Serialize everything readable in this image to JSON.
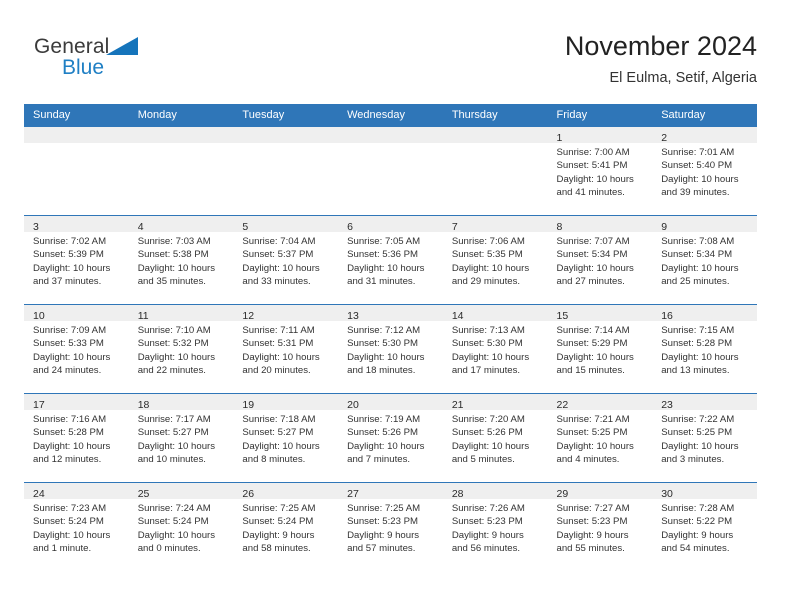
{
  "brand": {
    "word1": "General",
    "word2": "Blue",
    "triangle_color": "#1574bb",
    "blue_color": "#1f7fc4"
  },
  "header": {
    "title": "November 2024",
    "subtitle": "El Eulma, Setif, Algeria",
    "header_bg": "#2f76b8",
    "band_bg": "#efefef"
  },
  "weekday_headers": [
    "Sunday",
    "Monday",
    "Tuesday",
    "Wednesday",
    "Thursday",
    "Friday",
    "Saturday"
  ],
  "weeks": [
    [
      {
        "date": "",
        "lines": []
      },
      {
        "date": "",
        "lines": []
      },
      {
        "date": "",
        "lines": []
      },
      {
        "date": "",
        "lines": []
      },
      {
        "date": "",
        "lines": []
      },
      {
        "date": "1",
        "lines": [
          "Sunrise: 7:00 AM",
          "Sunset: 5:41 PM",
          "Daylight: 10 hours",
          "and 41 minutes."
        ]
      },
      {
        "date": "2",
        "lines": [
          "Sunrise: 7:01 AM",
          "Sunset: 5:40 PM",
          "Daylight: 10 hours",
          "and 39 minutes."
        ]
      }
    ],
    [
      {
        "date": "3",
        "lines": [
          "Sunrise: 7:02 AM",
          "Sunset: 5:39 PM",
          "Daylight: 10 hours",
          "and 37 minutes."
        ]
      },
      {
        "date": "4",
        "lines": [
          "Sunrise: 7:03 AM",
          "Sunset: 5:38 PM",
          "Daylight: 10 hours",
          "and 35 minutes."
        ]
      },
      {
        "date": "5",
        "lines": [
          "Sunrise: 7:04 AM",
          "Sunset: 5:37 PM",
          "Daylight: 10 hours",
          "and 33 minutes."
        ]
      },
      {
        "date": "6",
        "lines": [
          "Sunrise: 7:05 AM",
          "Sunset: 5:36 PM",
          "Daylight: 10 hours",
          "and 31 minutes."
        ]
      },
      {
        "date": "7",
        "lines": [
          "Sunrise: 7:06 AM",
          "Sunset: 5:35 PM",
          "Daylight: 10 hours",
          "and 29 minutes."
        ]
      },
      {
        "date": "8",
        "lines": [
          "Sunrise: 7:07 AM",
          "Sunset: 5:34 PM",
          "Daylight: 10 hours",
          "and 27 minutes."
        ]
      },
      {
        "date": "9",
        "lines": [
          "Sunrise: 7:08 AM",
          "Sunset: 5:34 PM",
          "Daylight: 10 hours",
          "and 25 minutes."
        ]
      }
    ],
    [
      {
        "date": "10",
        "lines": [
          "Sunrise: 7:09 AM",
          "Sunset: 5:33 PM",
          "Daylight: 10 hours",
          "and 24 minutes."
        ]
      },
      {
        "date": "11",
        "lines": [
          "Sunrise: 7:10 AM",
          "Sunset: 5:32 PM",
          "Daylight: 10 hours",
          "and 22 minutes."
        ]
      },
      {
        "date": "12",
        "lines": [
          "Sunrise: 7:11 AM",
          "Sunset: 5:31 PM",
          "Daylight: 10 hours",
          "and 20 minutes."
        ]
      },
      {
        "date": "13",
        "lines": [
          "Sunrise: 7:12 AM",
          "Sunset: 5:30 PM",
          "Daylight: 10 hours",
          "and 18 minutes."
        ]
      },
      {
        "date": "14",
        "lines": [
          "Sunrise: 7:13 AM",
          "Sunset: 5:30 PM",
          "Daylight: 10 hours",
          "and 17 minutes."
        ]
      },
      {
        "date": "15",
        "lines": [
          "Sunrise: 7:14 AM",
          "Sunset: 5:29 PM",
          "Daylight: 10 hours",
          "and 15 minutes."
        ]
      },
      {
        "date": "16",
        "lines": [
          "Sunrise: 7:15 AM",
          "Sunset: 5:28 PM",
          "Daylight: 10 hours",
          "and 13 minutes."
        ]
      }
    ],
    [
      {
        "date": "17",
        "lines": [
          "Sunrise: 7:16 AM",
          "Sunset: 5:28 PM",
          "Daylight: 10 hours",
          "and 12 minutes."
        ]
      },
      {
        "date": "18",
        "lines": [
          "Sunrise: 7:17 AM",
          "Sunset: 5:27 PM",
          "Daylight: 10 hours",
          "and 10 minutes."
        ]
      },
      {
        "date": "19",
        "lines": [
          "Sunrise: 7:18 AM",
          "Sunset: 5:27 PM",
          "Daylight: 10 hours",
          "and 8 minutes."
        ]
      },
      {
        "date": "20",
        "lines": [
          "Sunrise: 7:19 AM",
          "Sunset: 5:26 PM",
          "Daylight: 10 hours",
          "and 7 minutes."
        ]
      },
      {
        "date": "21",
        "lines": [
          "Sunrise: 7:20 AM",
          "Sunset: 5:26 PM",
          "Daylight: 10 hours",
          "and 5 minutes."
        ]
      },
      {
        "date": "22",
        "lines": [
          "Sunrise: 7:21 AM",
          "Sunset: 5:25 PM",
          "Daylight: 10 hours",
          "and 4 minutes."
        ]
      },
      {
        "date": "23",
        "lines": [
          "Sunrise: 7:22 AM",
          "Sunset: 5:25 PM",
          "Daylight: 10 hours",
          "and 3 minutes."
        ]
      }
    ],
    [
      {
        "date": "24",
        "lines": [
          "Sunrise: 7:23 AM",
          "Sunset: 5:24 PM",
          "Daylight: 10 hours",
          "and 1 minute."
        ]
      },
      {
        "date": "25",
        "lines": [
          "Sunrise: 7:24 AM",
          "Sunset: 5:24 PM",
          "Daylight: 10 hours",
          "and 0 minutes."
        ]
      },
      {
        "date": "26",
        "lines": [
          "Sunrise: 7:25 AM",
          "Sunset: 5:24 PM",
          "Daylight: 9 hours",
          "and 58 minutes."
        ]
      },
      {
        "date": "27",
        "lines": [
          "Sunrise: 7:25 AM",
          "Sunset: 5:23 PM",
          "Daylight: 9 hours",
          "and 57 minutes."
        ]
      },
      {
        "date": "28",
        "lines": [
          "Sunrise: 7:26 AM",
          "Sunset: 5:23 PM",
          "Daylight: 9 hours",
          "and 56 minutes."
        ]
      },
      {
        "date": "29",
        "lines": [
          "Sunrise: 7:27 AM",
          "Sunset: 5:23 PM",
          "Daylight: 9 hours",
          "and 55 minutes."
        ]
      },
      {
        "date": "30",
        "lines": [
          "Sunrise: 7:28 AM",
          "Sunset: 5:22 PM",
          "Daylight: 9 hours",
          "and 54 minutes."
        ]
      }
    ]
  ]
}
